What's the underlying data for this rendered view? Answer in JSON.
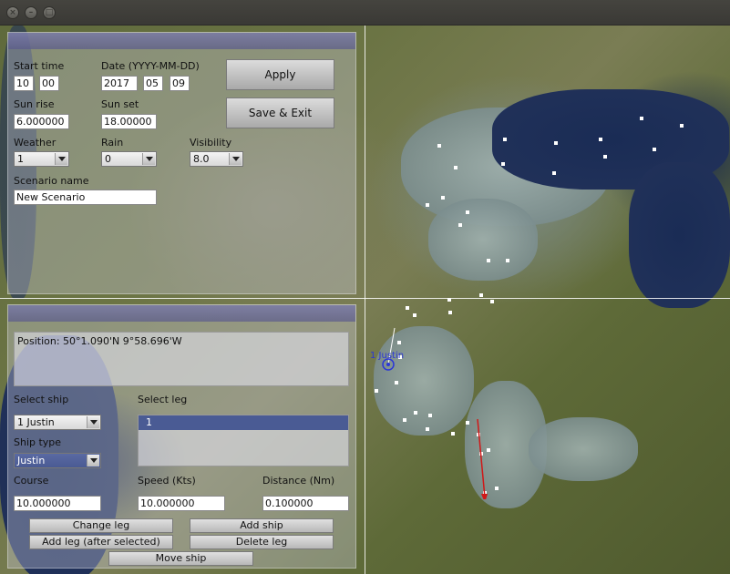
{
  "window": {
    "buttons": {
      "close": "×",
      "minimize": "–",
      "maximize": "□"
    }
  },
  "scenario": {
    "start_time_label": "Start time",
    "start_hour": "10",
    "start_minute": "00",
    "date_label": "Date (YYYY-MM-DD)",
    "date_year": "2017",
    "date_month": "05",
    "date_day": "09",
    "sun_rise_label": "Sun rise",
    "sun_rise_value": "6.000000",
    "sun_set_label": "Sun set",
    "sun_set_value": "18.00000",
    "weather_label": "Weather",
    "weather_value": "1",
    "rain_label": "Rain",
    "rain_value": "0",
    "visibility_label": "Visibility",
    "visibility_value": "8.0",
    "scenario_name_label": "Scenario name",
    "scenario_name_value": "New Scenario",
    "apply_label": "Apply",
    "save_exit_label": "Save & Exit"
  },
  "ship": {
    "position_text": "Position: 50°1.090'N 9°58.696'W",
    "select_ship_label": "Select ship",
    "select_ship_value": "1 Justin",
    "select_leg_label": "Select leg",
    "legs": [
      "1"
    ],
    "ship_type_label": "Ship type",
    "ship_type_value": "Justin",
    "course_label": "Course",
    "course_value": "10.000000",
    "speed_label": "Speed (Kts)",
    "speed_value": "10.000000",
    "distance_label": "Distance (Nm)",
    "distance_value": "0.100000",
    "change_leg_label": "Change leg",
    "add_ship_label": "Add ship",
    "add_leg_label": "Add leg (after selected)",
    "delete_leg_label": "Delete leg",
    "move_ship_label": "Move ship"
  },
  "map": {
    "ship_marker_label": "1 Justin"
  }
}
